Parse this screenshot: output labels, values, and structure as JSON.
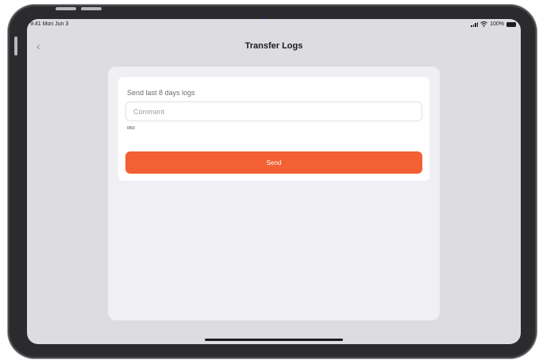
{
  "status_bar": {
    "time": "9:41 Mon Jun 3",
    "battery": "100%"
  },
  "nav": {
    "back_icon": "‹",
    "title": "Transfer Logs"
  },
  "form": {
    "section_label": "Send last 8 days logs",
    "comment_value": "",
    "comment_placeholder": "Comment",
    "char_counter": "0/60",
    "send_label": "Send"
  },
  "colors": {
    "accent": "#f26033",
    "screen_background": "#dcdce1",
    "panel_background": "#efeff4",
    "card_background": "#ffffff"
  }
}
